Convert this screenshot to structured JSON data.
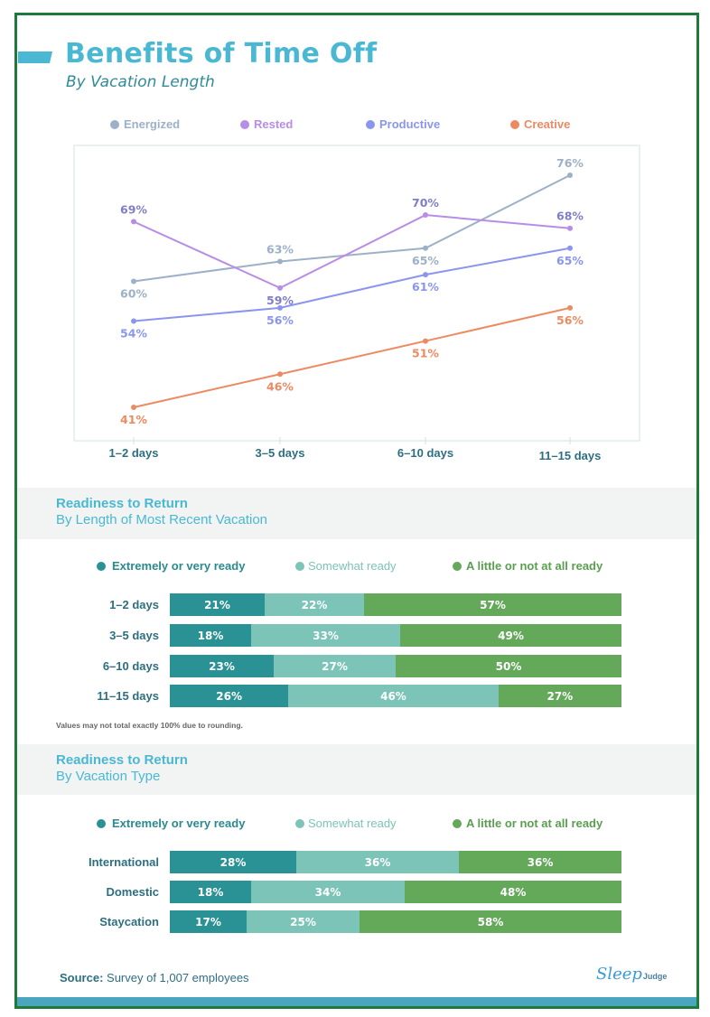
{
  "header": {
    "title": "Benefits of Time Off",
    "subtitle": "By Vacation Length"
  },
  "colors": {
    "title": "#4ab8d2",
    "energized": "#9cb0c8",
    "rested": "#b88de6",
    "productive": "#8a96ee",
    "creative": "#ec8a62",
    "extremely_ready": "#2a9294",
    "somewhat_ready": "#7cc3b8",
    "not_ready": "#64a85a",
    "frame": "#1f7a3a"
  },
  "chart_data": [
    {
      "type": "line",
      "title": "Benefits of Time Off",
      "subtitle": "By Vacation Length",
      "xlabel": "",
      "ylabel": "",
      "categories": [
        "1–2 days",
        "3–5 days",
        "6–10 days",
        "11–15 days"
      ],
      "series": [
        {
          "name": "Energized",
          "values": [
            60,
            63,
            65,
            76
          ],
          "labels": [
            "60%",
            "63%",
            "65%",
            "76%"
          ],
          "label_pos": [
            "below",
            "above",
            "below",
            "above"
          ]
        },
        {
          "name": "Rested",
          "values": [
            69,
            59,
            70,
            68
          ],
          "labels": [
            "69%",
            "59%",
            "70%",
            "68%"
          ],
          "label_pos": [
            "above",
            "below",
            "above",
            "above"
          ]
        },
        {
          "name": "Productive",
          "values": [
            54,
            56,
            61,
            65
          ],
          "labels": [
            "54%",
            "56%",
            "61%",
            "65%"
          ],
          "label_pos": [
            "below",
            "below",
            "below",
            "below"
          ]
        },
        {
          "name": "Creative",
          "values": [
            41,
            46,
            51,
            56
          ],
          "labels": [
            "41%",
            "46%",
            "51%",
            "56%"
          ],
          "label_pos": [
            "below",
            "below",
            "below",
            "below"
          ]
        }
      ],
      "ylim": [
        35,
        81
      ],
      "grid": false,
      "legend": "top"
    },
    {
      "type": "bar",
      "stacked": true,
      "orientation": "horizontal",
      "title": "Readiness to Return",
      "subtitle": "By Length of Most Recent Vacation",
      "categories": [
        "1–2 days",
        "3–5 days",
        "6–10 days",
        "11–15 days"
      ],
      "series": [
        {
          "name": "Extremely or very ready",
          "values": [
            21,
            18,
            23,
            26
          ]
        },
        {
          "name": "Somewhat ready",
          "values": [
            22,
            33,
            27,
            46
          ]
        },
        {
          "name": "A little or not at all ready",
          "values": [
            57,
            49,
            50,
            27
          ]
        }
      ],
      "note": "Values may not total exactly 100% due to rounding.",
      "legend": "top"
    },
    {
      "type": "bar",
      "stacked": true,
      "orientation": "horizontal",
      "title": "Readiness to Return",
      "subtitle": "By Vacation Type",
      "categories": [
        "International",
        "Domestic",
        "Staycation"
      ],
      "series": [
        {
          "name": "Extremely or very ready",
          "values": [
            28,
            18,
            17
          ]
        },
        {
          "name": "Somewhat ready",
          "values": [
            36,
            34,
            25
          ]
        },
        {
          "name": "A little or not at all ready",
          "values": [
            36,
            48,
            58
          ]
        }
      ],
      "legend": "top"
    }
  ],
  "footer": {
    "source_label": "Source:",
    "source_text": " Survey of 1,007 employees",
    "logo_script": "Sleep",
    "logo_word": "Judge"
  }
}
